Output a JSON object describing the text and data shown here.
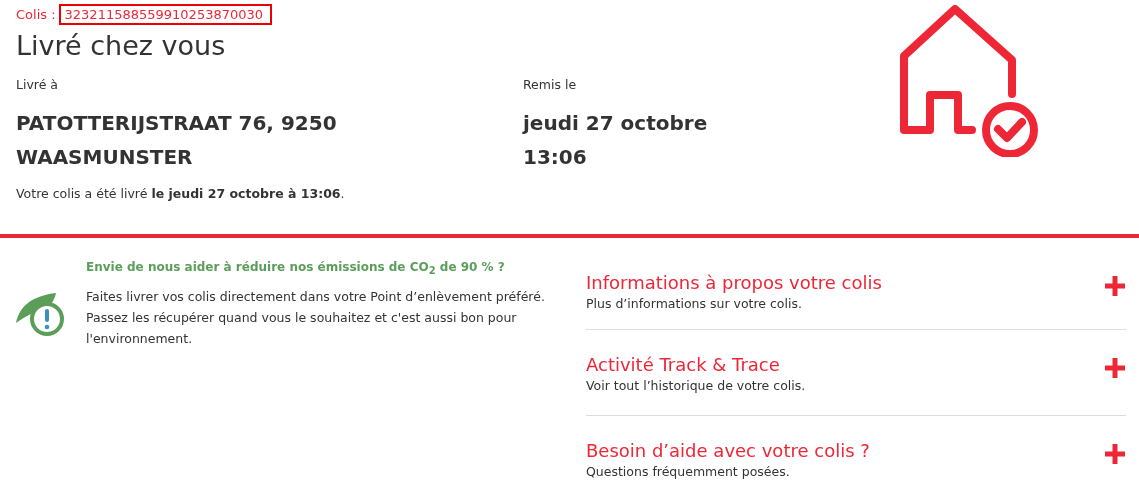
{
  "parcel": {
    "label": "Colis :",
    "number": "323211588559910253870030"
  },
  "title": "Livré chez vous",
  "delivered_to": {
    "label": "Livré à",
    "value": "PATOTTERIJSTRAAT 76, 9250 WAASMUNSTER"
  },
  "handed_over": {
    "label": "Remis le",
    "value_date": "jeudi 27 octobre",
    "value_time": "13:06"
  },
  "summary": "Votre colis a été livré **le jeudi 27 octobre à 13:06**.",
  "eco_tip": {
    "title": "Envie de nous aider à réduire nos émissions de CO$_{2}$ de 90 % ?",
    "text": "Faites livrer vos colis directement dans votre Point d’enlèvement préféré. Passez les récupérer quand vous le souhaitez et c'est aussi bon pour l'environnement."
  },
  "sections": [
    {
      "title": "Informations à propos votre colis",
      "subtitle": "Plus d’informations sur votre colis.",
      "expanded": false
    },
    {
      "title": "Activité Track & Trace",
      "subtitle": "Voir tout l’historique de votre colis.",
      "expanded": false
    },
    {
      "title": "Besoin d’aide avec votre colis ?",
      "subtitle": "Questions fréquemment posées.",
      "expanded": false
    }
  ]
}
